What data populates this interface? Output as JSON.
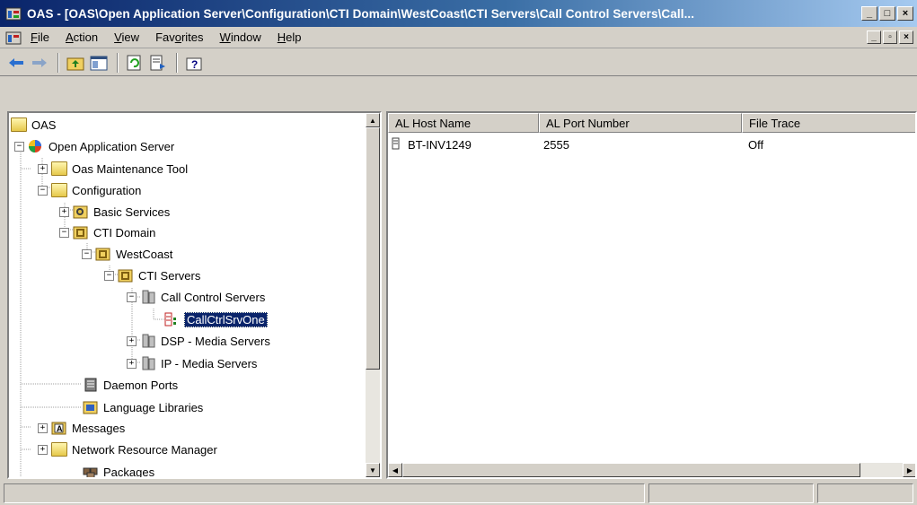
{
  "window": {
    "title": "OAS - [OAS\\Open Application Server\\Configuration\\CTI Domain\\WestCoast\\CTI Servers\\Call Control Servers\\Call..."
  },
  "menu": [
    {
      "label": "File",
      "key": "F"
    },
    {
      "label": "Action",
      "key": "A"
    },
    {
      "label": "View",
      "key": "V"
    },
    {
      "label": "Favorites",
      "key": "o"
    },
    {
      "label": "Window",
      "key": "W"
    },
    {
      "label": "Help",
      "key": "H"
    }
  ],
  "toolbar": [
    "back-icon",
    "forward-icon",
    "up-folder-icon",
    "show-tree-icon",
    "refresh-icon",
    "export-list-icon",
    "help-icon"
  ],
  "tree": {
    "items": [
      {
        "label": "OAS"
      },
      {
        "label": "Open Application Server"
      },
      {
        "label": "Oas Maintenance Tool"
      },
      {
        "label": "Configuration"
      },
      {
        "label": "Basic Services"
      },
      {
        "label": "CTI Domain"
      },
      {
        "label": "WestCoast"
      },
      {
        "label": "CTI Servers"
      },
      {
        "label": "Call Control Servers"
      },
      {
        "label": "CallCtrlSrvOne"
      },
      {
        "label": "DSP - Media Servers"
      },
      {
        "label": "IP - Media Servers"
      },
      {
        "label": "Daemon Ports"
      },
      {
        "label": "Language Libraries"
      },
      {
        "label": "Messages"
      },
      {
        "label": "Network Resource Manager"
      },
      {
        "label": "Packages"
      }
    ]
  },
  "list": {
    "columns": [
      "AL Host Name",
      "AL Port Number",
      "File Trace"
    ],
    "rows": [
      {
        "host": "BT-INV1249",
        "port": "2555",
        "trace": "Off"
      }
    ]
  },
  "colors": {
    "title_start": "#0a246a",
    "title_end": "#a6caf0",
    "selection": "#0a246a"
  }
}
